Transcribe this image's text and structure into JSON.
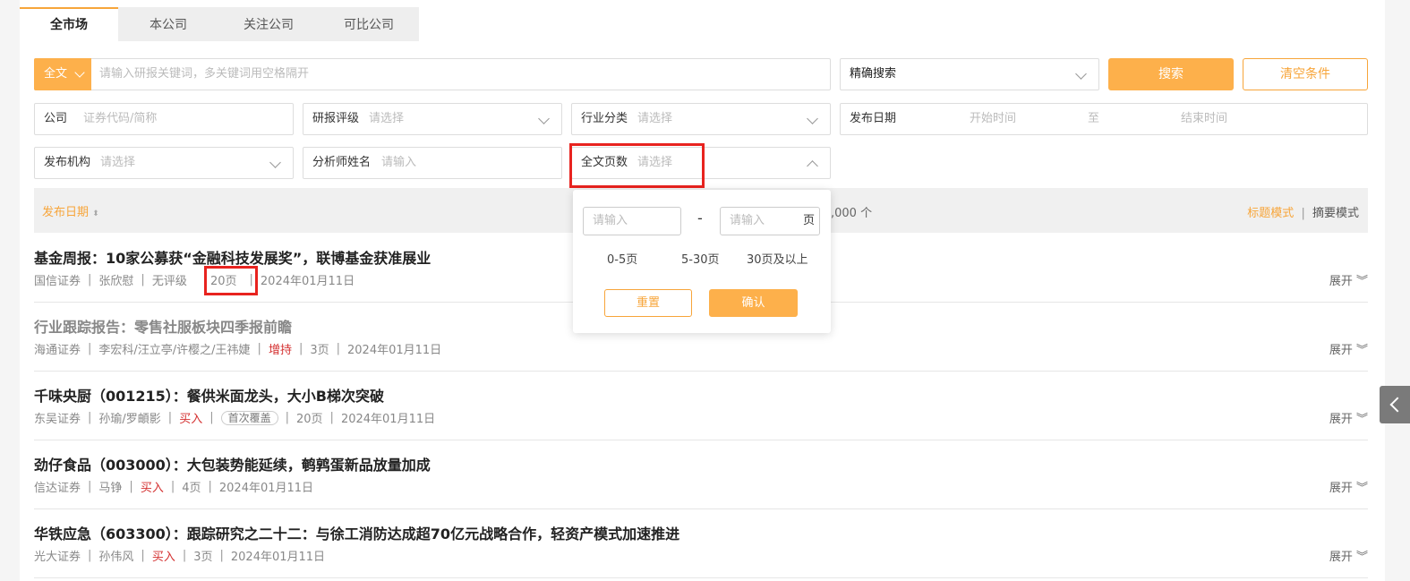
{
  "tabs": [
    "全市场",
    "本公司",
    "关注公司",
    "可比公司"
  ],
  "search": {
    "scope": "全文",
    "placeholder": "请输入研报关键词，多关键词用空格隔开",
    "mode": "精确搜索",
    "search_btn": "搜索",
    "clear_btn": "清空条件"
  },
  "filters": {
    "company_label": "公司",
    "company_ph": "证券代码/简称",
    "rating_label": "研报评级",
    "rating_ph": "请选择",
    "industry_label": "行业分类",
    "industry_ph": "请选择",
    "date_label": "发布日期",
    "date_start": "开始时间",
    "date_to": "至",
    "date_end": "结束时间",
    "org_label": "发布机构",
    "org_ph": "请选择",
    "analyst_label": "分析师姓名",
    "analyst_ph": "请输入",
    "pages_label": "全文页数",
    "pages_ph": "请选择"
  },
  "list_header": {
    "sort_label": "发布日期",
    "count_text": ",000 个",
    "title_mode": "标题模式",
    "divider": "|",
    "summary_mode": "摘要模式"
  },
  "dropdown": {
    "min_ph": "请输入",
    "dash": "-",
    "max_ph": "请输入",
    "unit": "页",
    "opt1": "0-5页",
    "opt2": "5-30页",
    "opt3": "30页及以上",
    "reset": "重置",
    "confirm": "确认"
  },
  "items": [
    {
      "title": "基金周报：10家公募获“金融科技发展奖”，联博基金获准展业",
      "org": "国信证券",
      "analyst": "张欣慰",
      "rating": "无评级",
      "pages": "20页",
      "date": "2024年01月11日",
      "expand": "展开"
    },
    {
      "title": "行业跟踪报告：零售社服板块四季报前瞻",
      "org": "海通证券",
      "analyst": "李宏科/汪立亭/许樱之/王祎婕",
      "rating": "增持",
      "pages": "3页",
      "date": "2024年01月11日",
      "expand": "展开"
    },
    {
      "title": "千味央厨（001215）：餐供米面龙头，大小B梯次突破",
      "org": "东吴证券",
      "analyst": "孙瑜/罗頔影",
      "rating": "买入",
      "tag": "首次覆盖",
      "pages": "20页",
      "date": "2024年01月11日",
      "expand": "展开"
    },
    {
      "title": "劲仔食品（003000）：大包装势能延续，鹌鹑蛋新品放量加成",
      "org": "信达证券",
      "analyst": "马铮",
      "rating": "买入",
      "pages": "4页",
      "date": "2024年01月11日",
      "expand": "展开"
    },
    {
      "title": "华铁应急（603300）：跟踪研究之二十二：与徐工消防达成超70亿元战略合作，轻资产模式加速推进",
      "org": "光大证券",
      "analyst": "孙伟风",
      "rating": "买入",
      "pages": "3页",
      "date": "2024年01月11日",
      "expand": "展开"
    }
  ],
  "colors": {
    "accent": "#fdb04b",
    "highlight": "#e8231f",
    "buy": "#d43030"
  }
}
